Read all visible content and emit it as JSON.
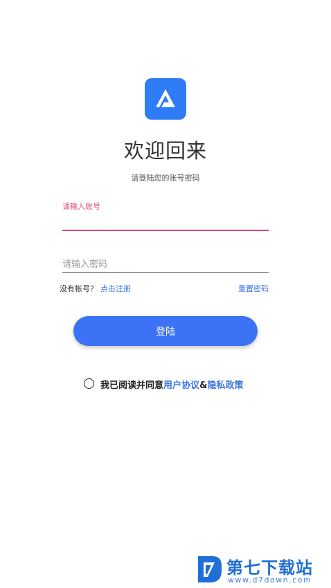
{
  "header": {
    "logo_icon": "triangle-logo-icon",
    "title": "欢迎回来",
    "subtitle": "请登陆您的账号密码"
  },
  "form": {
    "account_label": "请输入账号",
    "account_value": "",
    "password_placeholder": "请输入密码",
    "password_value": ""
  },
  "links": {
    "no_account": "没有帐号？",
    "register": "点击注册",
    "reset_password": "重置密码"
  },
  "login_button": {
    "label": "登陆"
  },
  "agreement": {
    "checked": false,
    "prefix": "我已阅读并同意",
    "user_agreement": "用户协议",
    "separator": "&",
    "privacy_policy": "隐私政策"
  },
  "watermark": {
    "title": "第七下载站",
    "url": "www.d7down.com"
  },
  "colors": {
    "accent": "#3b72f6",
    "logo": "#2f7df6",
    "focus": "#e0477f",
    "link": "#3b74e0"
  }
}
